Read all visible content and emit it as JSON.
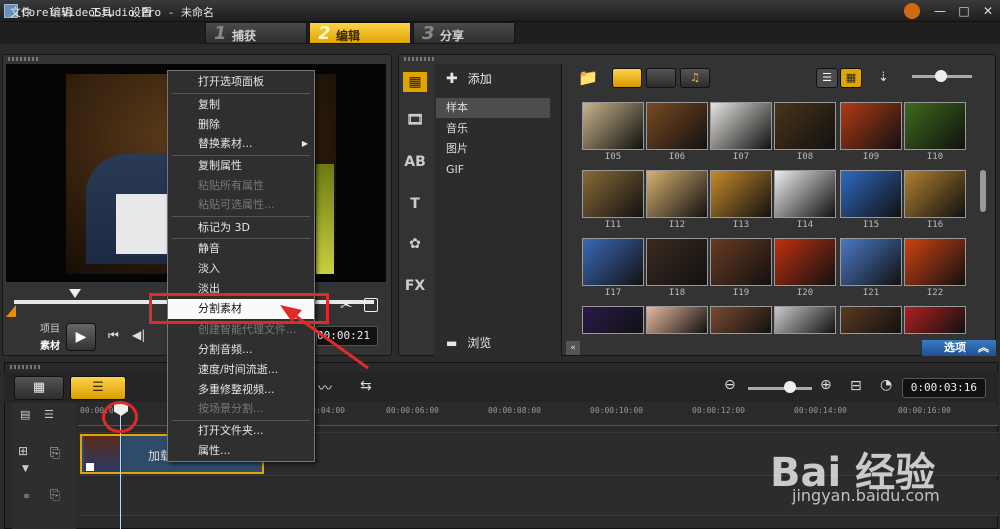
{
  "window": {
    "title": "Corel VideoStudio Pro - 未命名",
    "minimize": "—",
    "restore": "□",
    "close": "✕"
  },
  "menu": {
    "items": [
      "文件",
      "编辑",
      "工具",
      "设置"
    ]
  },
  "steps": [
    {
      "num": "1",
      "label": "捕获"
    },
    {
      "num": "2",
      "label": "编辑"
    },
    {
      "num": "3",
      "label": "分享"
    }
  ],
  "preview": {
    "project_label": "项目",
    "clip_label": "素材",
    "timecode": "00:00:21"
  },
  "library": {
    "add_label": "添加",
    "browse_label": "浏览",
    "categories": [
      "样本",
      "音乐",
      "图片",
      "GIF"
    ],
    "selected_category": "样本",
    "side_icons": [
      "media-icon",
      "transition-icon",
      "title-ab-icon",
      "text-icon",
      "graphic-icon",
      "fx-icon"
    ],
    "side_icon_glyphs": [
      "▦",
      "🎞",
      "AB",
      "T",
      "✿",
      "FX"
    ],
    "thumbnails": [
      {
        "label": "I05",
        "color": "#c9b48a"
      },
      {
        "label": "I06",
        "color": "#7a4a22"
      },
      {
        "label": "I07",
        "color": "#e6e4df"
      },
      {
        "label": "I08",
        "color": "#4a3418"
      },
      {
        "label": "I09",
        "color": "#b23a14"
      },
      {
        "label": "I10",
        "color": "#3e6a1c"
      },
      {
        "label": "I11",
        "color": "#8a6a3a"
      },
      {
        "label": "I12",
        "color": "#d8b070"
      },
      {
        "label": "I13",
        "color": "#c78a2a"
      },
      {
        "label": "I14",
        "color": "#eeeeee"
      },
      {
        "label": "I15",
        "color": "#2e6ac0"
      },
      {
        "label": "I16",
        "color": "#b08030"
      },
      {
        "label": "I17",
        "color": "#3a6ab8"
      },
      {
        "label": "I18",
        "color": "#3a2a20"
      },
      {
        "label": "I19",
        "color": "#6a3a22"
      },
      {
        "label": "I20",
        "color": "#c03010"
      },
      {
        "label": "I21",
        "color": "#4a7ac8"
      },
      {
        "label": "I22",
        "color": "#d04010"
      },
      {
        "label": "",
        "color": "#2a1a4a"
      },
      {
        "label": "",
        "color": "#e8b8a0"
      },
      {
        "label": "",
        "color": "#7a4a30"
      },
      {
        "label": "",
        "color": "#cacaca"
      },
      {
        "label": "",
        "color": "#5a3a20"
      },
      {
        "label": "",
        "color": "#b02020"
      }
    ],
    "options_label": "选项"
  },
  "timeline": {
    "duration": "0:00:03:16",
    "ticks": [
      "00:00:00",
      "00:00:04:00",
      "00:00:06:00",
      "00:00:08:00",
      "00:00:10:00",
      "00:00:12:00",
      "00:00:14:00",
      "00:00:16:00"
    ],
    "clip_label": "加载"
  },
  "context_menu": {
    "items": [
      {
        "label": "打开选项面板",
        "state": "normal"
      },
      {
        "label": "复制",
        "state": "normal"
      },
      {
        "label": "删除",
        "state": "normal"
      },
      {
        "label": "替换素材...",
        "state": "normal",
        "submenu": "▶"
      },
      {
        "label": "复制属性",
        "state": "normal"
      },
      {
        "label": "粘贴所有属性",
        "state": "disabled"
      },
      {
        "label": "粘贴可选属性...",
        "state": "disabled"
      },
      {
        "label": "标记为 3D",
        "state": "normal"
      },
      {
        "label": "静音",
        "state": "normal"
      },
      {
        "label": "淡入",
        "state": "normal"
      },
      {
        "label": "淡出",
        "state": "normal"
      },
      {
        "label": "分割素材",
        "state": "highlighted"
      },
      {
        "label": "创建智能代理文件...",
        "state": "disabled"
      },
      {
        "label": "分割音频...",
        "state": "normal"
      },
      {
        "label": "速度/时间流逝...",
        "state": "normal"
      },
      {
        "label": "多重修整视频...",
        "state": "normal"
      },
      {
        "label": "按场景分割...",
        "state": "disabled"
      },
      {
        "label": "打开文件夹...",
        "state": "normal"
      },
      {
        "label": "属性...",
        "state": "normal"
      }
    ]
  },
  "watermark": {
    "brand": "Bai 经验",
    "url": "jingyan.baidu.com"
  },
  "colors": {
    "accent": "#f0b400",
    "annotation": "#e02a2a",
    "highlight_bg": "#fafafa"
  }
}
